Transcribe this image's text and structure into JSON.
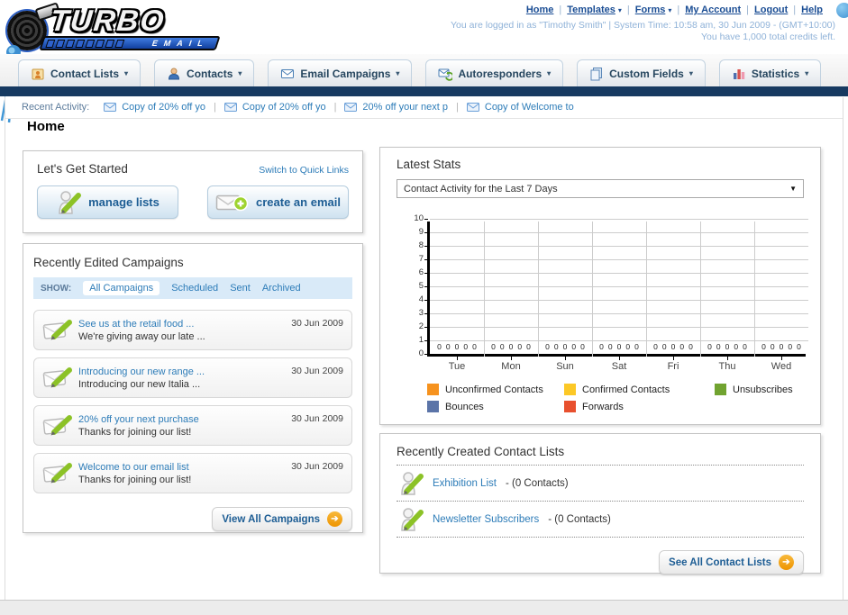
{
  "ui": {
    "separator": "|",
    "caret": "▾",
    "select_caret": "▼",
    "arrow": "➔"
  },
  "header": {
    "logo": {
      "title": "TURBO",
      "subtitle": "EMAIL"
    },
    "nav": [
      {
        "label": "Home",
        "dropdown": false
      },
      {
        "label": "Templates",
        "dropdown": true
      },
      {
        "label": "Forms",
        "dropdown": true
      },
      {
        "label": "My Account",
        "dropdown": false
      },
      {
        "label": "Logout",
        "dropdown": false
      },
      {
        "label": "Help",
        "dropdown": false
      }
    ],
    "login_status": "You are logged in as \"Timothy Smith\" | System Time: 10:58 am, 30 Jun 2009 - (GMT+10:00)",
    "credits": "You have 1,000 total credits left."
  },
  "tabs": [
    {
      "label": "Contact Lists",
      "icon": "contact-lists-icon"
    },
    {
      "label": "Contacts",
      "icon": "contacts-icon"
    },
    {
      "label": "Email Campaigns",
      "icon": "email-campaigns-icon"
    },
    {
      "label": "Autoresponders",
      "icon": "autoresponders-icon"
    },
    {
      "label": "Custom Fields",
      "icon": "custom-fields-icon"
    },
    {
      "label": "Statistics",
      "icon": "statistics-icon"
    }
  ],
  "recent_activity": {
    "label": "Recent Activity:",
    "items": [
      "Copy of 20% off yo",
      "Copy of 20% off yo",
      "20% off your next p",
      "Copy of Welcome to"
    ]
  },
  "page_title": "Home",
  "get_started": {
    "title": "Let's Get Started",
    "switch_link": "Switch to Quick Links",
    "buttons": [
      {
        "label": "manage lists",
        "icon": "person-pencil-icon"
      },
      {
        "label": "create an email",
        "icon": "envelope-plus-icon"
      }
    ]
  },
  "campaigns": {
    "title": "Recently Edited Campaigns",
    "show_label": "SHOW:",
    "filters": [
      "All Campaigns",
      "Scheduled",
      "Sent",
      "Archived"
    ],
    "active_filter": "All Campaigns",
    "items": [
      {
        "title": "See us at the retail food ...",
        "subtitle": "We're giving away our late ...",
        "date": "30 Jun 2009"
      },
      {
        "title": "Introducing our new range ...",
        "subtitle": "Introducing our new Italia ...",
        "date": "30 Jun 2009"
      },
      {
        "title": "20% off your next purchase",
        "subtitle": "Thanks for joining our list!",
        "date": "30 Jun 2009"
      },
      {
        "title": "Welcome to our email list",
        "subtitle": "Thanks for joining our list!",
        "date": "30 Jun 2009"
      }
    ],
    "view_all_label": "View All Campaigns"
  },
  "stats": {
    "title": "Latest Stats",
    "dropdown_value": "Contact Activity for the Last 7 Days"
  },
  "chart_data": {
    "type": "bar",
    "title": "Contact Activity for the Last 7 Days",
    "categories": [
      "Tue",
      "Mon",
      "Sun",
      "Sat",
      "Fri",
      "Thu",
      "Wed"
    ],
    "series": [
      {
        "name": "Unconfirmed Contacts",
        "color": "#f6921e",
        "values": [
          0,
          0,
          0,
          0,
          0,
          0,
          0
        ]
      },
      {
        "name": "Confirmed Contacts",
        "color": "#fcc826",
        "values": [
          0,
          0,
          0,
          0,
          0,
          0,
          0
        ]
      },
      {
        "name": "Unsubscribes",
        "color": "#71a330",
        "values": [
          0,
          0,
          0,
          0,
          0,
          0,
          0
        ]
      },
      {
        "name": "Bounces",
        "color": "#5b74a8",
        "values": [
          0,
          0,
          0,
          0,
          0,
          0,
          0
        ]
      },
      {
        "name": "Forwards",
        "color": "#e8502e",
        "values": [
          0,
          0,
          0,
          0,
          0,
          0,
          0
        ]
      }
    ],
    "ylim": [
      0,
      10
    ],
    "yticks": [
      0,
      1,
      2,
      3,
      4,
      5,
      6,
      7,
      8,
      9,
      10
    ],
    "grid": true,
    "legend_position": "bottom",
    "value_labels_shown": true
  },
  "contact_lists": {
    "title": "Recently Created Contact Lists",
    "items": [
      {
        "name": "Exhibition List",
        "detail": "- (0 Contacts)"
      },
      {
        "name": "Newsletter Subscribers",
        "detail": "- (0 Contacts)"
      }
    ],
    "see_all_label": "See All Contact Lists"
  }
}
